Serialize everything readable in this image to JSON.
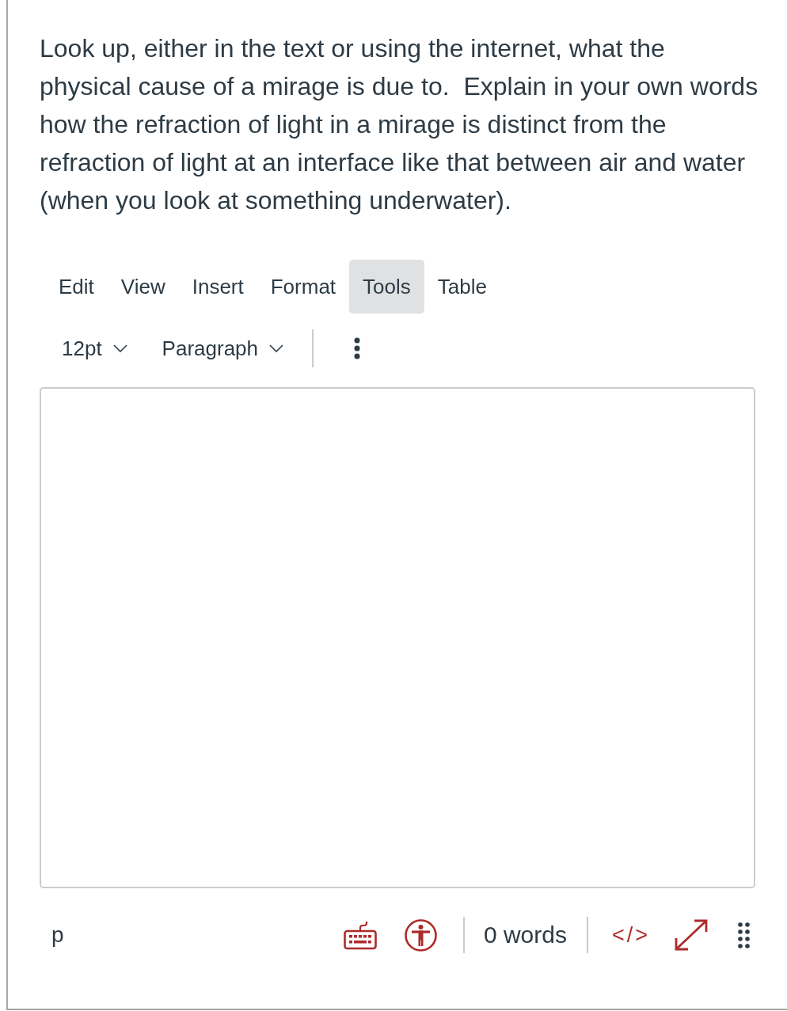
{
  "question": {
    "text": "Look up, either in the text or using the internet, what the physical cause of a mirage is due to.  Explain in your own words how the refraction of light in a mirage is distinct from the refraction of light at an interface like that between air and water (when you look at something underwater)."
  },
  "editor": {
    "menu": [
      {
        "label": "Edit",
        "selected": false
      },
      {
        "label": "View",
        "selected": false
      },
      {
        "label": "Insert",
        "selected": false
      },
      {
        "label": "Format",
        "selected": false
      },
      {
        "label": "Tools",
        "selected": true
      },
      {
        "label": "Table",
        "selected": false
      }
    ],
    "toolbar": {
      "font_size": "12pt",
      "block_format": "Paragraph"
    },
    "status_bar": {
      "path": "p",
      "word_count": "0 words",
      "html_toggle": "</>"
    }
  }
}
